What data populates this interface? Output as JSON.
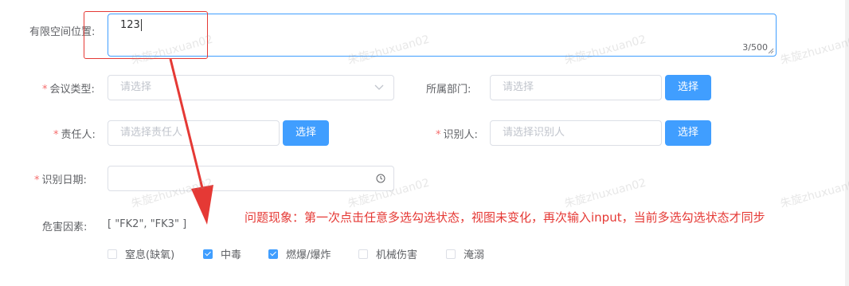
{
  "form": {
    "location": {
      "label": "有限空间位置:",
      "value": "123",
      "counter": "3/500"
    },
    "meeting_type": {
      "label": "会议类型:",
      "placeholder": "请选择"
    },
    "department": {
      "label": "所属部门:",
      "placeholder": "请选择",
      "button": "选择"
    },
    "responsible": {
      "label": "责任人:",
      "placeholder": "请选择责任人",
      "button": "选择"
    },
    "identifier": {
      "label": "识别人:",
      "placeholder": "请选择识别人",
      "button": "选择"
    },
    "identify_date": {
      "label": "识别日期:"
    },
    "hazards": {
      "label": "危害因素:",
      "value_text": "[ \"FK2\", \"FK3\" ]",
      "options": [
        {
          "label": "窒息(缺氧)",
          "checked": false
        },
        {
          "label": "中毒",
          "checked": true
        },
        {
          "label": "燃爆/爆炸",
          "checked": true
        },
        {
          "label": "机械伤害",
          "checked": false
        },
        {
          "label": "淹溺",
          "checked": false
        }
      ]
    }
  },
  "annotation": {
    "note": "问题现象：第一次点击任意多选勾选状态，视图未变化，再次输入input，当前多选勾选状态才同步",
    "color": "#e53935"
  },
  "watermark": {
    "text": "朱旋zhuxuan02"
  },
  "required_mark": "*",
  "colors": {
    "primary": "#409eff",
    "required": "#f56c6c"
  },
  "icons": {
    "select_arrow": "chevron-down-icon",
    "date": "clock-icon"
  }
}
